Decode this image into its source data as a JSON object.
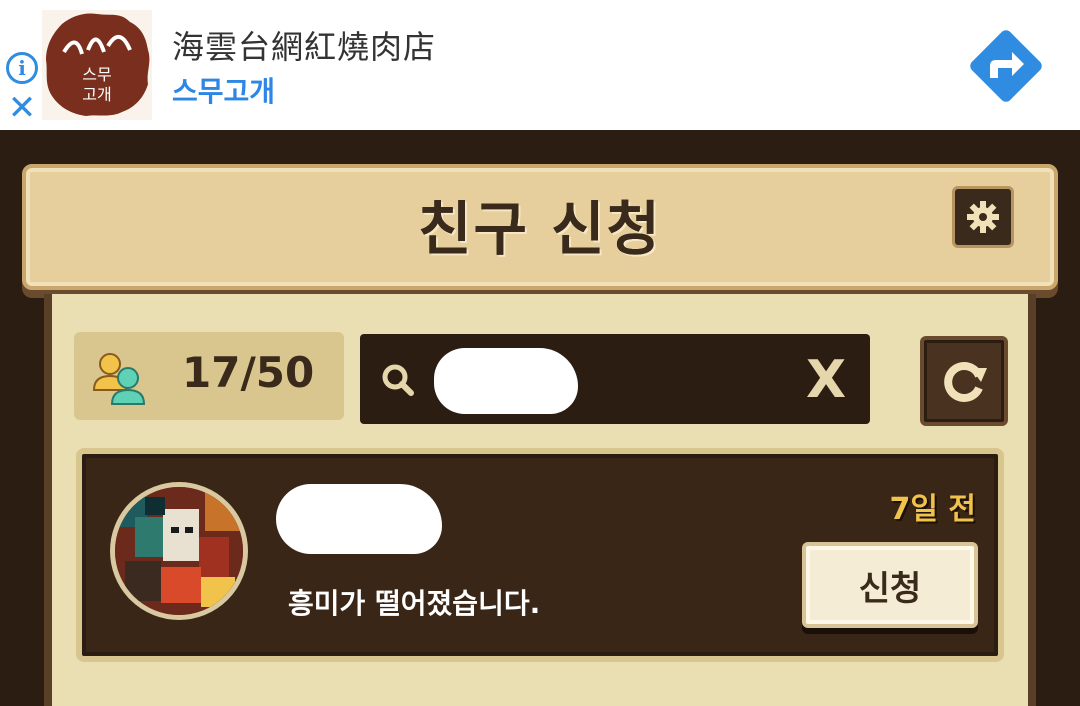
{
  "ad": {
    "title": "海雲台網紅燒肉店",
    "subtitle": "스무고개",
    "logo_text_top": "스무",
    "logo_text_bottom": "고개",
    "info_icon": "info-icon",
    "close_icon": "close-icon",
    "close_glyph": "✕",
    "info_glyph": "i",
    "directions_icon": "directions-icon"
  },
  "header": {
    "title": "친구 신청",
    "settings_icon": "gear-icon"
  },
  "friends": {
    "count": "17/50"
  },
  "search": {
    "clear_label": "X"
  },
  "requests": [
    {
      "status_message": "흥미가 떨어졌습니다.",
      "time_ago": "7일 전",
      "action_label": "신청"
    }
  ],
  "colors": {
    "accent_blue": "#2f8ce0",
    "panel_tan": "#e6cf9c",
    "dark_brown": "#2b1d12",
    "time_gold": "#f2c34a"
  }
}
